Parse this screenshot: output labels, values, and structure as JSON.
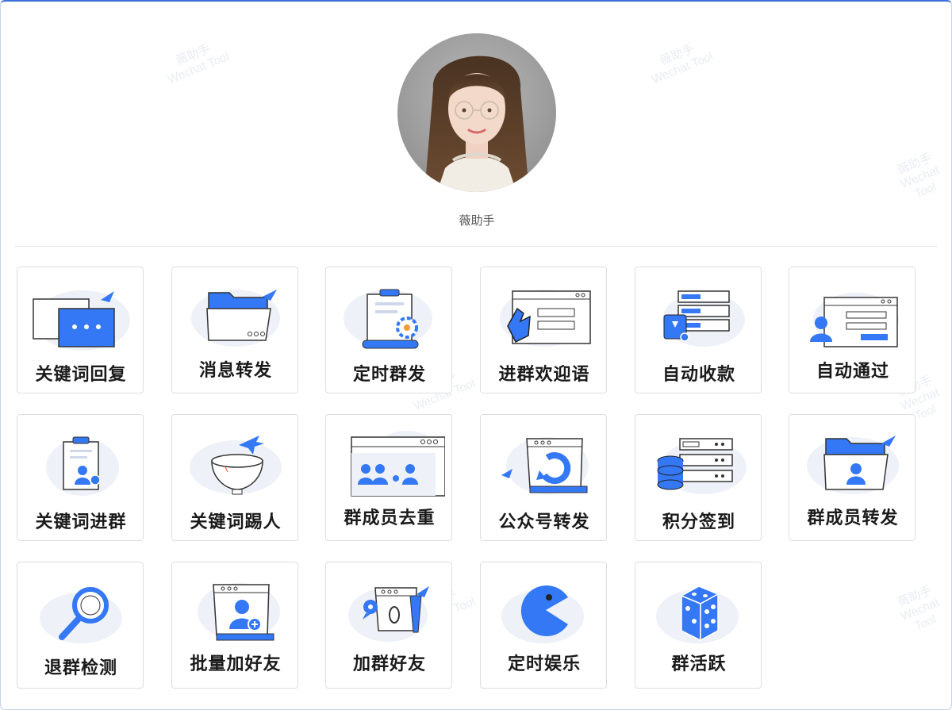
{
  "profile": {
    "username": "薇助手"
  },
  "watermark": [
    "薇助手",
    "Wechat Tool"
  ],
  "colors": {
    "accent": "#3478f6",
    "blob": "#eef1f8",
    "line": "#333333"
  },
  "features": [
    {
      "label": "关键词回复",
      "icon": "chat-bubble-icon"
    },
    {
      "label": "消息转发",
      "icon": "folder-send-icon"
    },
    {
      "label": "定时群发",
      "icon": "clipboard-gear-icon"
    },
    {
      "label": "进群欢迎语",
      "icon": "clapping-window-icon"
    },
    {
      "label": "自动收款",
      "icon": "server-wallet-icon"
    },
    {
      "label": "自动通过",
      "icon": "user-form-icon"
    },
    {
      "label": "关键词进群",
      "icon": "clipboard-user-icon"
    },
    {
      "label": "关键词踢人",
      "icon": "bowl-plane-icon"
    },
    {
      "label": "群成员去重",
      "icon": "group-window-icon"
    },
    {
      "label": "公众号转发",
      "icon": "calendar-refresh-icon"
    },
    {
      "label": "积分签到",
      "icon": "server-database-icon"
    },
    {
      "label": "群成员转发",
      "icon": "folder-user-icon"
    },
    {
      "label": "退群检测",
      "icon": "magnifier-icon"
    },
    {
      "label": "批量加好友",
      "icon": "calendar-add-user-icon"
    },
    {
      "label": "加群好友",
      "icon": "calendar-chat-icon"
    },
    {
      "label": "定时娱乐",
      "icon": "pacman-icon"
    },
    {
      "label": "群活跃",
      "icon": "dice-icon"
    }
  ]
}
